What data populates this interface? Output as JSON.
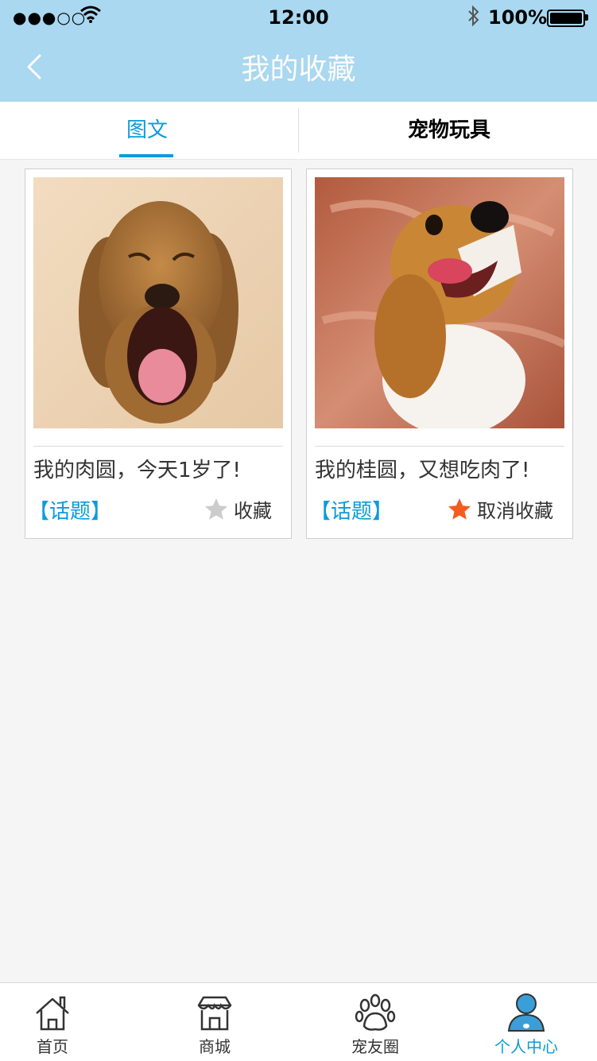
{
  "status_bar": {
    "time": "12:00",
    "battery": "100%",
    "signal": "●●●○○"
  },
  "nav": {
    "title": "我的收藏",
    "back_icon": "chevron-left-icon"
  },
  "tabs": [
    {
      "label": "图文",
      "active": true
    },
    {
      "label": "宠物玩具",
      "active": false
    }
  ],
  "cards": [
    {
      "image": "dog-photo-yawning",
      "caption": "我的肉圆，今天1岁了!",
      "topic": "【话题】",
      "fav_label": "收藏",
      "favorited": false
    },
    {
      "image": "dog-photo-beagle",
      "caption": "我的桂圆，又想吃肉了!",
      "topic": "【话题】",
      "fav_label": "取消收藏",
      "favorited": true
    }
  ],
  "tabbar": [
    {
      "label": "首页",
      "icon": "home-icon",
      "active": false
    },
    {
      "label": "商城",
      "icon": "store-icon",
      "active": false
    },
    {
      "label": "宠友圈",
      "icon": "paw-icon",
      "active": false
    },
    {
      "label": "个人中心",
      "icon": "user-icon",
      "active": true
    }
  ],
  "colors": {
    "header": "#a9d8f0",
    "accent": "#0a9cda",
    "text": "#333333",
    "title": "#fdfbfb",
    "star_active": "#f45b1e",
    "star_inactive": "#cccccc"
  }
}
